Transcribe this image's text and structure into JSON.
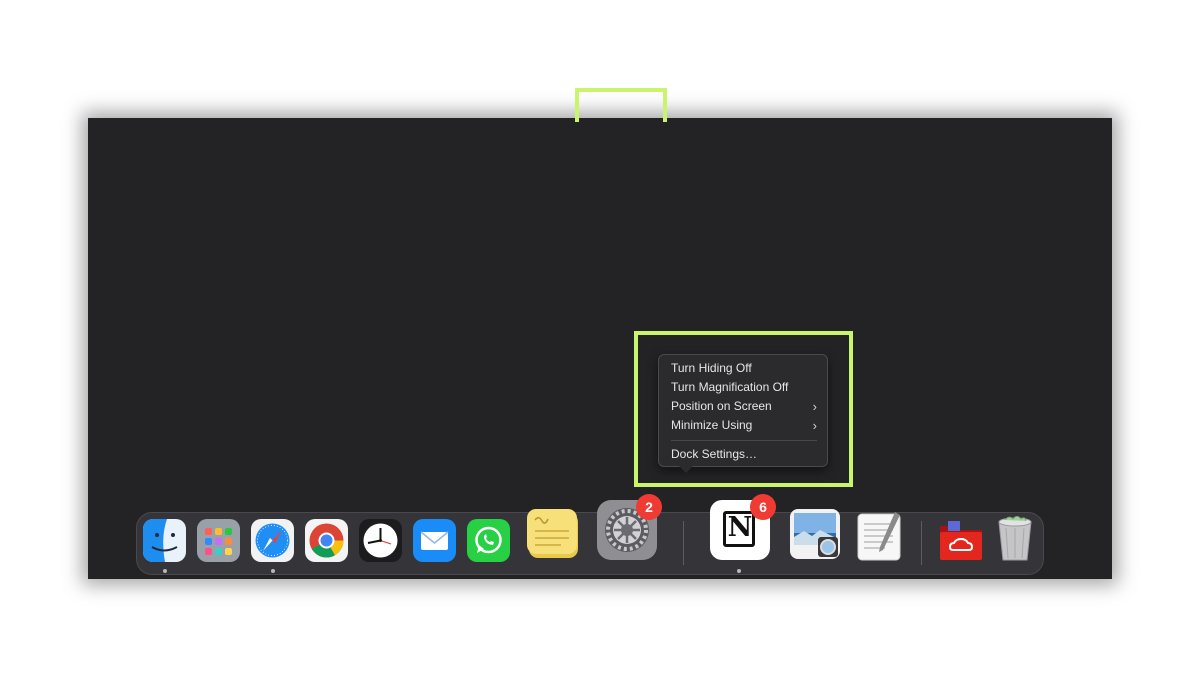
{
  "context_menu": {
    "items": [
      {
        "label": "Turn Hiding Off",
        "submenu": false
      },
      {
        "label": "Turn Magnification Off",
        "submenu": false
      },
      {
        "label": "Position on Screen",
        "submenu": true
      },
      {
        "label": "Minimize Using",
        "submenu": true
      }
    ],
    "settings_label": "Dock Settings…",
    "chevron": "›"
  },
  "dock": {
    "apps": [
      {
        "name": "Finder",
        "icon": "finder-icon",
        "running": true
      },
      {
        "name": "Launchpad",
        "icon": "launchpad-icon",
        "running": false
      },
      {
        "name": "Safari",
        "icon": "safari-icon",
        "running": true
      },
      {
        "name": "Google Chrome",
        "icon": "chrome-icon",
        "running": false
      },
      {
        "name": "Clock",
        "icon": "clock-icon",
        "running": false
      },
      {
        "name": "Mail",
        "icon": "mail-icon",
        "running": false
      },
      {
        "name": "WhatsApp",
        "icon": "whatsapp-icon",
        "running": false
      },
      {
        "name": "Stickies",
        "icon": "stickies-icon",
        "running": false
      },
      {
        "name": "System Settings",
        "icon": "gear-icon",
        "running": false,
        "badge": "2"
      },
      {
        "name": "Notion",
        "icon": "notion-icon",
        "running": true,
        "badge": "6",
        "notion_letter": "N"
      },
      {
        "name": "Preview",
        "icon": "preview-icon",
        "running": false
      },
      {
        "name": "TextEdit",
        "icon": "textedit-icon",
        "running": false
      },
      {
        "name": "Adobe Creative Cloud",
        "icon": "creative-cloud-folder-icon",
        "running": false
      },
      {
        "name": "Trash",
        "icon": "trash-icon",
        "running": false
      }
    ]
  },
  "colors": {
    "highlight": "#c8f56b",
    "screen_bg": "#232326",
    "badge": "#ef3b33"
  }
}
